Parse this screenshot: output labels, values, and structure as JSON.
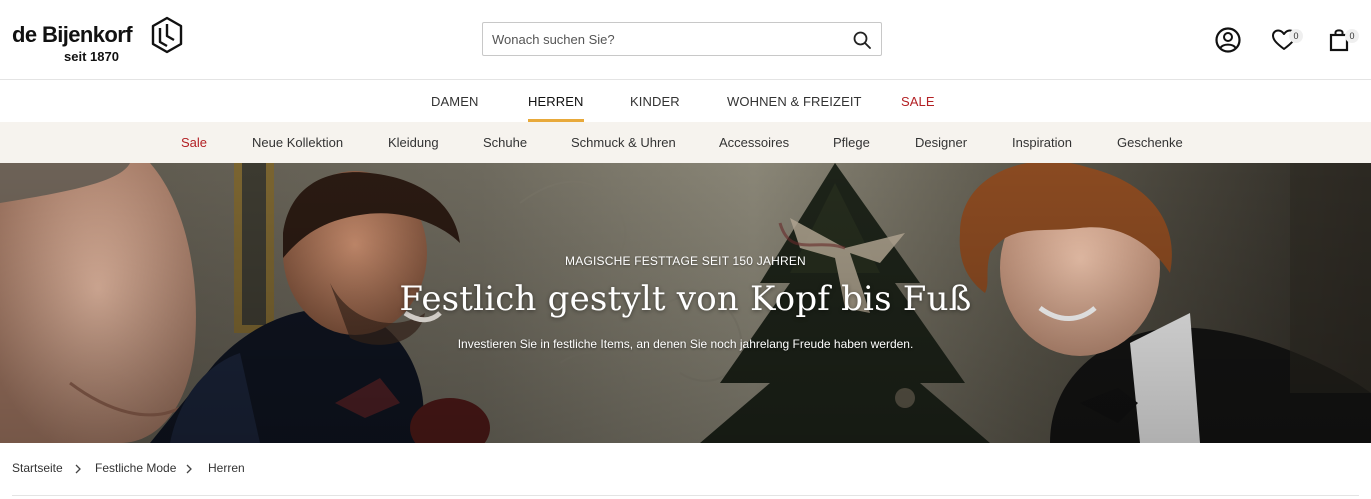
{
  "header": {
    "logo_text": "de Bijenkorf",
    "logo_sub": "seit 1870",
    "search_placeholder": "Wonach suchen Sie?",
    "wishlist_count": "0",
    "cart_count": "0"
  },
  "main_nav": [
    {
      "label": "DAMEN"
    },
    {
      "label": "HERREN"
    },
    {
      "label": "KINDER"
    },
    {
      "label": "WOHNEN & FREIZEIT"
    },
    {
      "label": "SALE"
    }
  ],
  "sub_nav": [
    {
      "label": "Sale"
    },
    {
      "label": "Neue Kollektion"
    },
    {
      "label": "Kleidung"
    },
    {
      "label": "Schuhe"
    },
    {
      "label": "Schmuck & Uhren"
    },
    {
      "label": "Accessoires"
    },
    {
      "label": "Pflege"
    },
    {
      "label": "Designer"
    },
    {
      "label": "Inspiration"
    },
    {
      "label": "Geschenke"
    }
  ],
  "hero": {
    "kicker": "MAGISCHE FESTTAGE SEIT 150 JAHREN",
    "title": "Festlich gestylt von Kopf bis Fuß",
    "subtitle": "Investieren Sie in festliche Items, an denen Sie noch jahrelang Freude haben werden."
  },
  "breadcrumb": [
    {
      "label": "Startseite"
    },
    {
      "label": "Festliche Mode"
    },
    {
      "label": "Herren"
    }
  ],
  "colors": {
    "accent_underline": "#e8a93a",
    "sale_red": "#b32024",
    "subnav_bg": "#f6f3ee"
  }
}
